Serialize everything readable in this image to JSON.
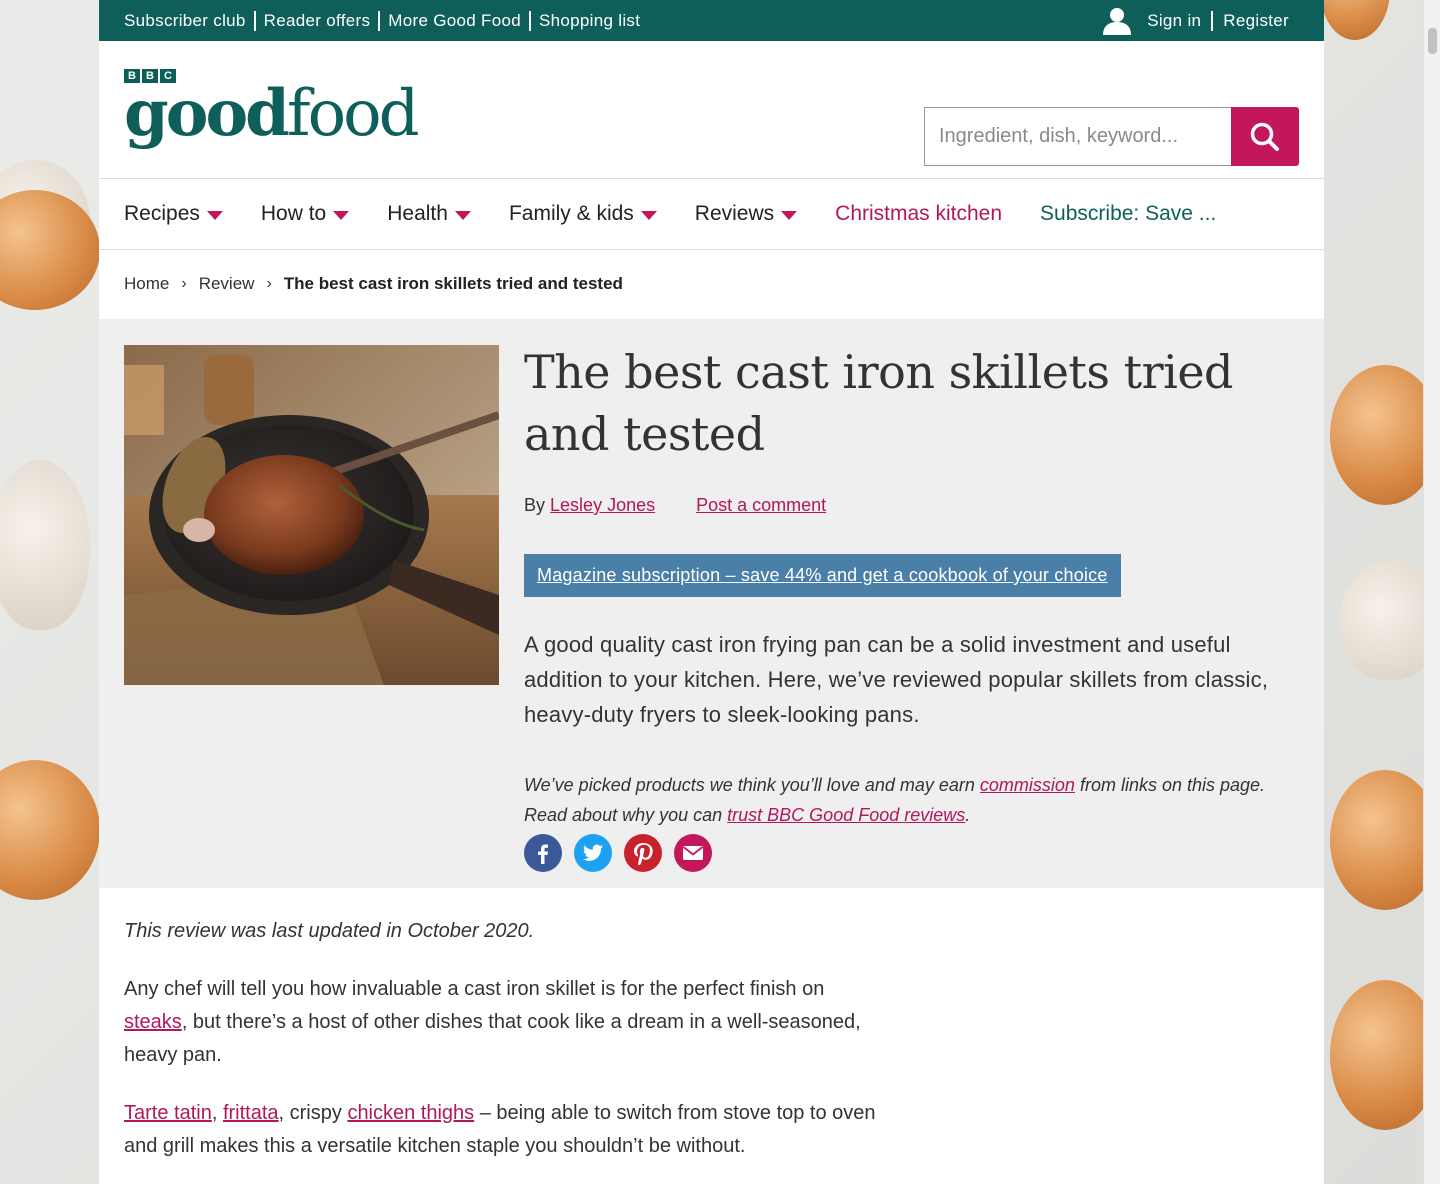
{
  "topbar": {
    "links": [
      "Subscriber club",
      "Reader offers",
      "More Good Food",
      "Shopping list"
    ],
    "sign_in": "Sign in",
    "register": "Register"
  },
  "logo": {
    "bbc": [
      "B",
      "B",
      "C"
    ],
    "good": "good",
    "food": "food"
  },
  "search": {
    "placeholder": "Ingredient, dish, keyword..."
  },
  "nav": {
    "items": [
      {
        "label": "Recipes"
      },
      {
        "label": "How to"
      },
      {
        "label": "Health"
      },
      {
        "label": "Family & kids"
      },
      {
        "label": "Reviews"
      }
    ],
    "christmas": "Christmas kitchen",
    "subscribe": "Subscribe: Save ..."
  },
  "breadcrumb": {
    "home": "Home",
    "review": "Review",
    "current": "The best cast iron skillets tried and tested"
  },
  "article": {
    "title": "The best cast iron skillets tried and tested",
    "by": "By",
    "author": "Lesley Jones",
    "comment": "Post a comment",
    "promo": "Magazine subscription – save 44% and get a cookbook of your choice",
    "lead": "A good quality cast iron frying pan can be a solid investment and useful addition to your kitchen. Here, we’ve reviewed popular skillets from classic, heavy-duty fryers to sleek-looking pans.",
    "disclaimer_1": "We’ve picked products we think you’ll love and may earn",
    "disclaimer_link_1": "commission",
    "disclaimer_2": "from links on this page. Read about why you can",
    "disclaimer_link_2": "trust BBC Good Food reviews",
    "disclaimer_3": "."
  },
  "body": {
    "updated": "This review was last updated in October 2020.",
    "p1_a": "Any chef will tell you how invaluable a cast iron skillet is for the perfect finish on",
    "p1_link": "steaks",
    "p1_b": ", but there’s a host of other dishes that cook like a dream in a well-seasoned, heavy pan.",
    "p2_link1": "Tarte tatin",
    "p2_sep1": ",",
    "p2_link2": "frittata",
    "p2_sep2": ", crispy",
    "p2_link3": "chicken thighs",
    "p2_b": "– being able to switch from stove top to oven and grill makes this a versatile kitchen staple you shouldn’t be without."
  },
  "colors": {
    "teal": "#0e5e5a",
    "magenta": "#c2185b",
    "promo_blue": "#4a7fa8"
  }
}
